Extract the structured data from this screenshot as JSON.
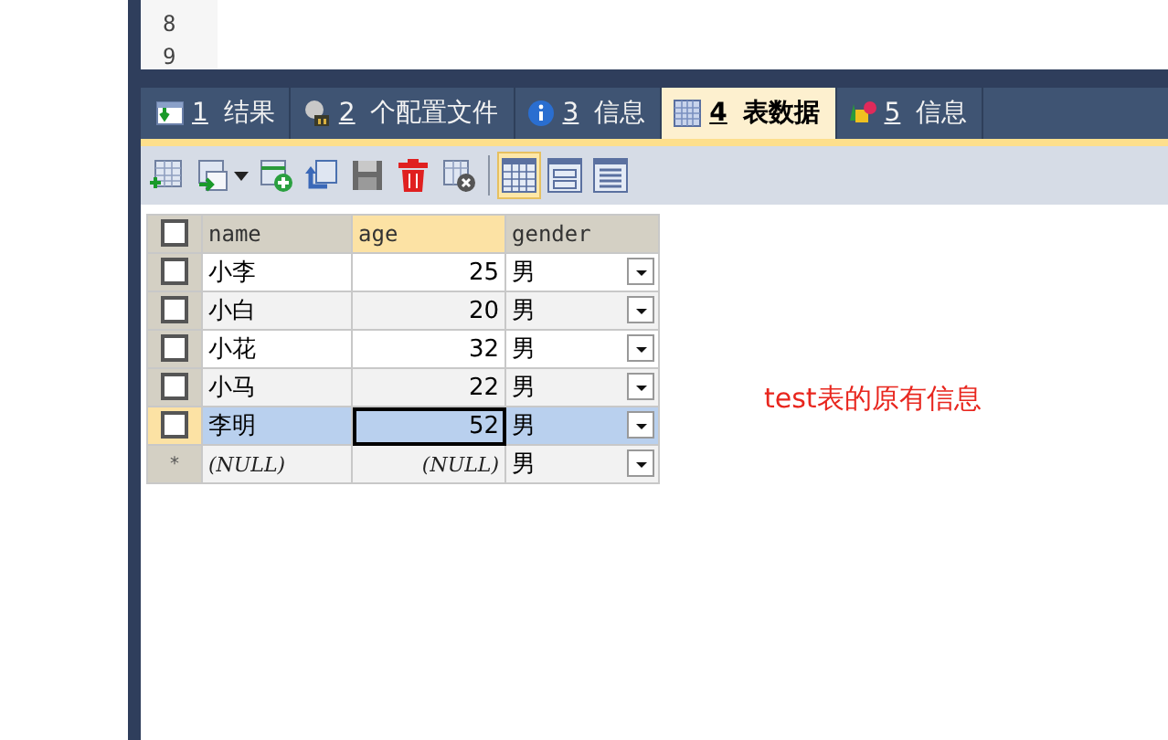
{
  "editor": {
    "line_numbers": [
      "8",
      "9"
    ]
  },
  "tabs": [
    {
      "num": "1",
      "label": "结果",
      "selected": false
    },
    {
      "num": "2",
      "label": "个配置文件",
      "selected": false
    },
    {
      "num": "3",
      "label": "信息",
      "selected": false
    },
    {
      "num": "4",
      "label": "表数据",
      "selected": true
    },
    {
      "num": "5",
      "label": "信息",
      "selected": false
    }
  ],
  "toolbar": {
    "edit_buttons": [
      {
        "kind": "insert-row"
      },
      {
        "kind": "duplicate"
      },
      {
        "kind": "add"
      },
      {
        "kind": "refresh"
      },
      {
        "kind": "save"
      },
      {
        "kind": "delete"
      },
      {
        "kind": "cancel"
      }
    ],
    "view_buttons": [
      {
        "kind": "grid-view",
        "selected": true
      },
      {
        "kind": "form-view",
        "selected": false
      },
      {
        "kind": "text-view",
        "selected": false
      }
    ]
  },
  "table": {
    "all_checked": false,
    "columns": [
      {
        "name": "name",
        "kind": "text",
        "current": false
      },
      {
        "name": "age",
        "kind": "number",
        "current": true
      },
      {
        "name": "gender",
        "kind": "choice",
        "current": false
      }
    ],
    "rows": [
      {
        "selected": false,
        "checked": false,
        "cells": [
          "小李",
          "25",
          "男"
        ]
      },
      {
        "selected": false,
        "checked": false,
        "cells": [
          "小白",
          "20",
          "男"
        ]
      },
      {
        "selected": false,
        "checked": false,
        "cells": [
          "小花",
          "32",
          "男"
        ]
      },
      {
        "selected": false,
        "checked": false,
        "cells": [
          "小马",
          "22",
          "男"
        ]
      },
      {
        "selected": true,
        "checked": false,
        "cells": [
          "李明",
          "52",
          "男"
        ]
      }
    ],
    "new_row": {
      "marker": "*",
      "cells": [
        "(NULL)",
        "(NULL)",
        "男"
      ]
    }
  },
  "annotation": "test表的原有信息"
}
